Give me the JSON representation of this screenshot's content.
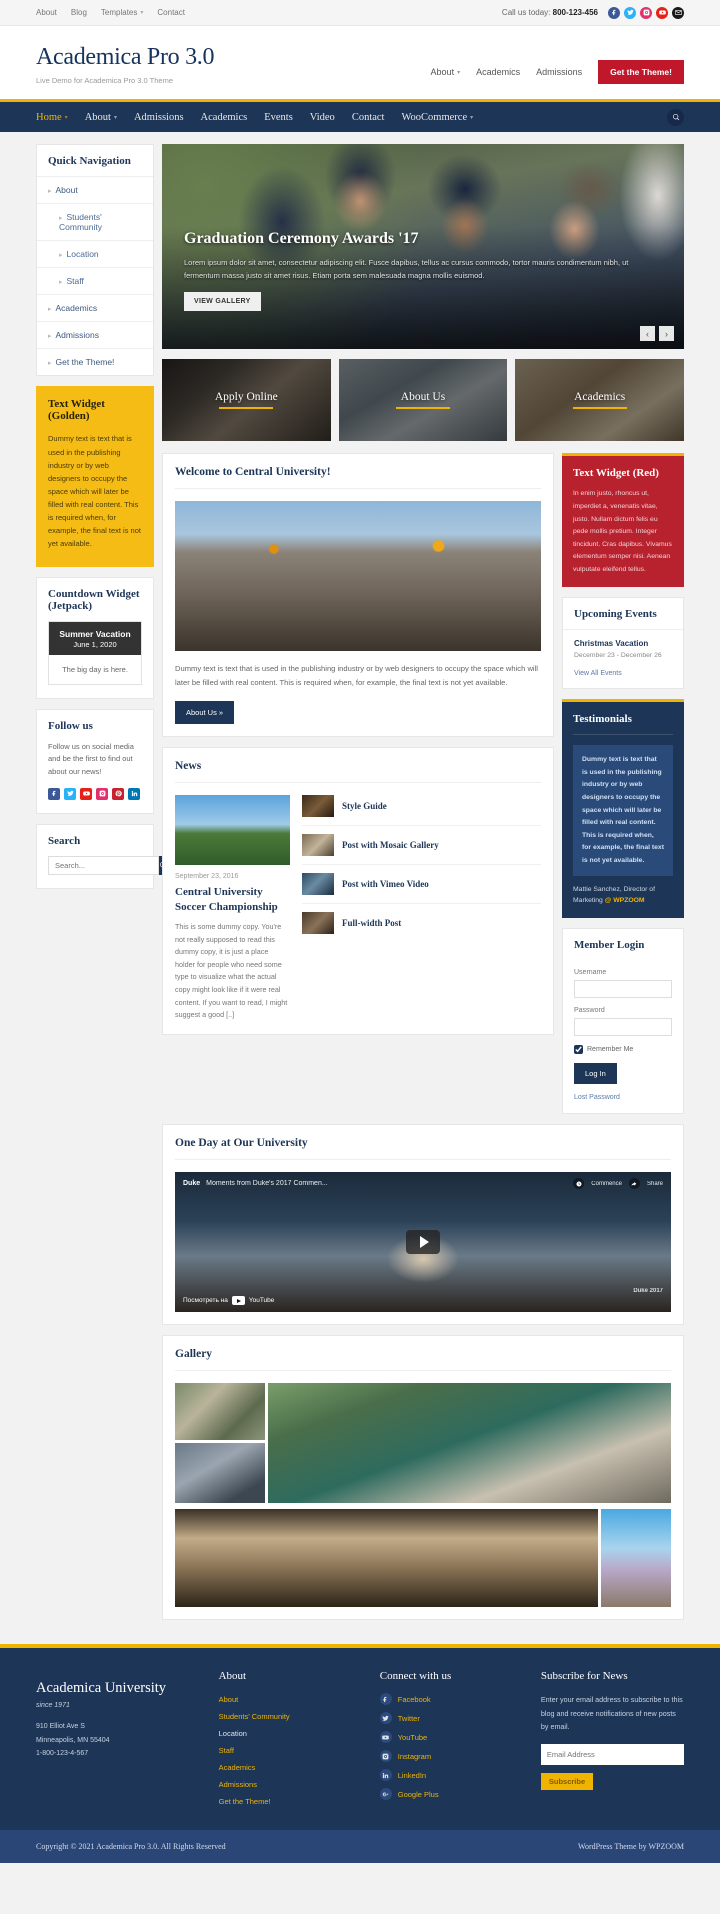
{
  "topbar": {
    "nav": [
      {
        "label": "About",
        "caret": false
      },
      {
        "label": "Blog",
        "caret": false
      },
      {
        "label": "Templates",
        "caret": true
      },
      {
        "label": "Contact",
        "caret": false
      }
    ],
    "call_label": "Call us today:",
    "call_number": "800-123-456",
    "socials": [
      {
        "name": "facebook-icon",
        "color": "#3b5998"
      },
      {
        "name": "twitter-icon",
        "color": "#29b2f5"
      },
      {
        "name": "instagram-icon",
        "color": "#e1306c"
      },
      {
        "name": "youtube-icon",
        "color": "#e62117"
      },
      {
        "name": "email-icon",
        "color": "#1a1a1a"
      }
    ]
  },
  "header": {
    "site_title": "Academica Pro 3.0",
    "tagline": "Live Demo for Academica Pro 3.0 Theme",
    "nav": [
      {
        "label": "About",
        "caret": true
      },
      {
        "label": "Academics",
        "caret": false
      },
      {
        "label": "Admissions",
        "caret": false
      }
    ],
    "cta": "Get the Theme!"
  },
  "mainnav": {
    "items": [
      {
        "label": "Home",
        "caret": true,
        "active": true
      },
      {
        "label": "About",
        "caret": true,
        "active": false
      },
      {
        "label": "Admissions",
        "caret": false,
        "active": false
      },
      {
        "label": "Academics",
        "caret": false,
        "active": false
      },
      {
        "label": "Events",
        "caret": false,
        "active": false
      },
      {
        "label": "Video",
        "caret": false,
        "active": false
      },
      {
        "label": "Contact",
        "caret": false,
        "active": false
      },
      {
        "label": "WooCommerce",
        "caret": true,
        "active": false
      }
    ]
  },
  "sidebar_left": {
    "quick_nav": {
      "title": "Quick Navigation",
      "items": [
        {
          "label": "About",
          "sub": false
        },
        {
          "label": "Students' Community",
          "sub": true
        },
        {
          "label": "Location",
          "sub": true
        },
        {
          "label": "Staff",
          "sub": true
        },
        {
          "label": "Academics",
          "sub": false
        },
        {
          "label": "Admissions",
          "sub": false
        },
        {
          "label": "Get the Theme!",
          "sub": false
        }
      ]
    },
    "golden": {
      "title": "Text Widget (Golden)",
      "body": "Dummy text is text that is used in the publishing industry or by web designers to occupy the space which will later be filled with real content. This is required when, for example, the final text is not yet available."
    },
    "countdown": {
      "title": "Countdown Widget (Jetpack)",
      "event": "Summer Vacation",
      "date": "June 1, 2020",
      "status": "The big day is here."
    },
    "follow": {
      "title": "Follow us",
      "body": "Follow us on social media and be the first to find out about our news!",
      "icons": [
        {
          "name": "facebook-icon",
          "color": "#3b5998"
        },
        {
          "name": "twitter-icon",
          "color": "#29b2f5"
        },
        {
          "name": "youtube-icon",
          "color": "#e62117"
        },
        {
          "name": "instagram-icon",
          "color": "#e1306c"
        },
        {
          "name": "pinterest-icon",
          "color": "#c8232c"
        },
        {
          "name": "linkedin-icon",
          "color": "#0077b5"
        }
      ]
    },
    "search": {
      "title": "Search",
      "placeholder": "Search..."
    }
  },
  "slider": {
    "title": "Graduation Ceremony Awards '17",
    "text": "Lorem ipsum dolor sit amet, consectetur adipiscing elit. Fusce dapibus, tellus ac cursus commodo, tortor mauris condimentum nibh, ut fermentum massa justo sit amet risus. Etiam porta sem malesuada magna mollis euismod.",
    "button": "VIEW GALLERY",
    "prev": "‹",
    "next": "›"
  },
  "features": [
    {
      "label": "Apply Online"
    },
    {
      "label": "About Us"
    },
    {
      "label": "Academics"
    }
  ],
  "welcome": {
    "title": "Welcome to Central University!",
    "body": "Dummy text is text that is used in the publishing industry or by web designers to occupy the space which will later be filled with real content. This is required when, for example, the final text is not yet available.",
    "button": "About Us »"
  },
  "news": {
    "title": "News",
    "featured": {
      "date": "September 23, 2016",
      "headline": "Central University Soccer Championship",
      "excerpt": "This is some dummy copy. You're not really supposed to read this dummy copy, it is just a place holder for people who need some type to visualize what the actual copy might look like if it were real content. If you want to read, I might suggest a good [..]"
    },
    "items": [
      {
        "title": "Style Guide"
      },
      {
        "title": "Post with Mosaic Gallery"
      },
      {
        "title": "Post with Vimeo Video"
      },
      {
        "title": "Full-width Post"
      }
    ]
  },
  "video": {
    "title": "One Day at Our University",
    "yt_brand": "Duke",
    "yt_title": "Moments from Duke's 2017 Commen...",
    "yt_share": "Share",
    "yt_watchlater": "Commence",
    "yt_watch_on": "Посмотреть на",
    "yt_label": "YouTube",
    "yt_watermark": "Duke 2017"
  },
  "gallery": {
    "title": "Gallery"
  },
  "sidebar_right": {
    "red": {
      "title": "Text Widget (Red)",
      "body": "In enim justo, rhoncus ut, imperdiet a, venenatis vitae, justo. Nullam dictum felis eu pede mollis pretium. Integer tincidunt. Cras dapibus. Vivamus elementum semper nisi. Aenean vulputate eleifend tellus."
    },
    "events": {
      "title": "Upcoming Events",
      "name": "Christmas Vacation",
      "date": "December 23 - December 26",
      "all_link": "View All Events"
    },
    "testimonials": {
      "title": "Testimonials",
      "quote": "Dummy text is text that is used in the publishing industry or by web designers to occupy the space which will later be filled with real content. This is required when, for example, the final text is not yet available.",
      "author": "Mattie Sanchez, Director of Marketing",
      "author_at": "@ WPZOOM"
    },
    "login": {
      "title": "Member Login",
      "username_label": "Username",
      "password_label": "Password",
      "remember_label": "Remember Me",
      "button": "Log In",
      "lost_password": "Lost Password"
    }
  },
  "footer": {
    "brand": {
      "name": "Academica University",
      "since": "since 1971",
      "address_line1": "910 Elliot Ave S",
      "address_line2": "Minneapolis, MN 55404",
      "phone": "1-800-123-4-567"
    },
    "about": {
      "title": "About",
      "links": [
        {
          "label": "About"
        },
        {
          "label": "Students' Community"
        },
        {
          "label": "Location"
        },
        {
          "label": "Staff"
        },
        {
          "label": "Academics"
        },
        {
          "label": "Admissions"
        },
        {
          "label": "Get the Theme!"
        }
      ]
    },
    "connect": {
      "title": "Connect with us",
      "links": [
        {
          "label": "Facebook",
          "icon": "facebook-icon"
        },
        {
          "label": "Twitter",
          "icon": "twitter-icon"
        },
        {
          "label": "YouTube",
          "icon": "youtube-icon"
        },
        {
          "label": "Instagram",
          "icon": "instagram-icon"
        },
        {
          "label": "LinkedIn",
          "icon": "linkedin-icon"
        },
        {
          "label": "Google Plus",
          "icon": "googleplus-icon"
        }
      ]
    },
    "subscribe": {
      "title": "Subscribe for News",
      "body": "Enter your email address to subscribe to this blog and receive notifications of new posts by email.",
      "placeholder": "Email Address",
      "button": "Subscribe"
    },
    "copyright": "Copyright © 2021 Academica Pro 3.0. All Rights Reserved",
    "credit_prefix": "WordPress Theme by ",
    "credit_brand": "WPZOOM"
  }
}
